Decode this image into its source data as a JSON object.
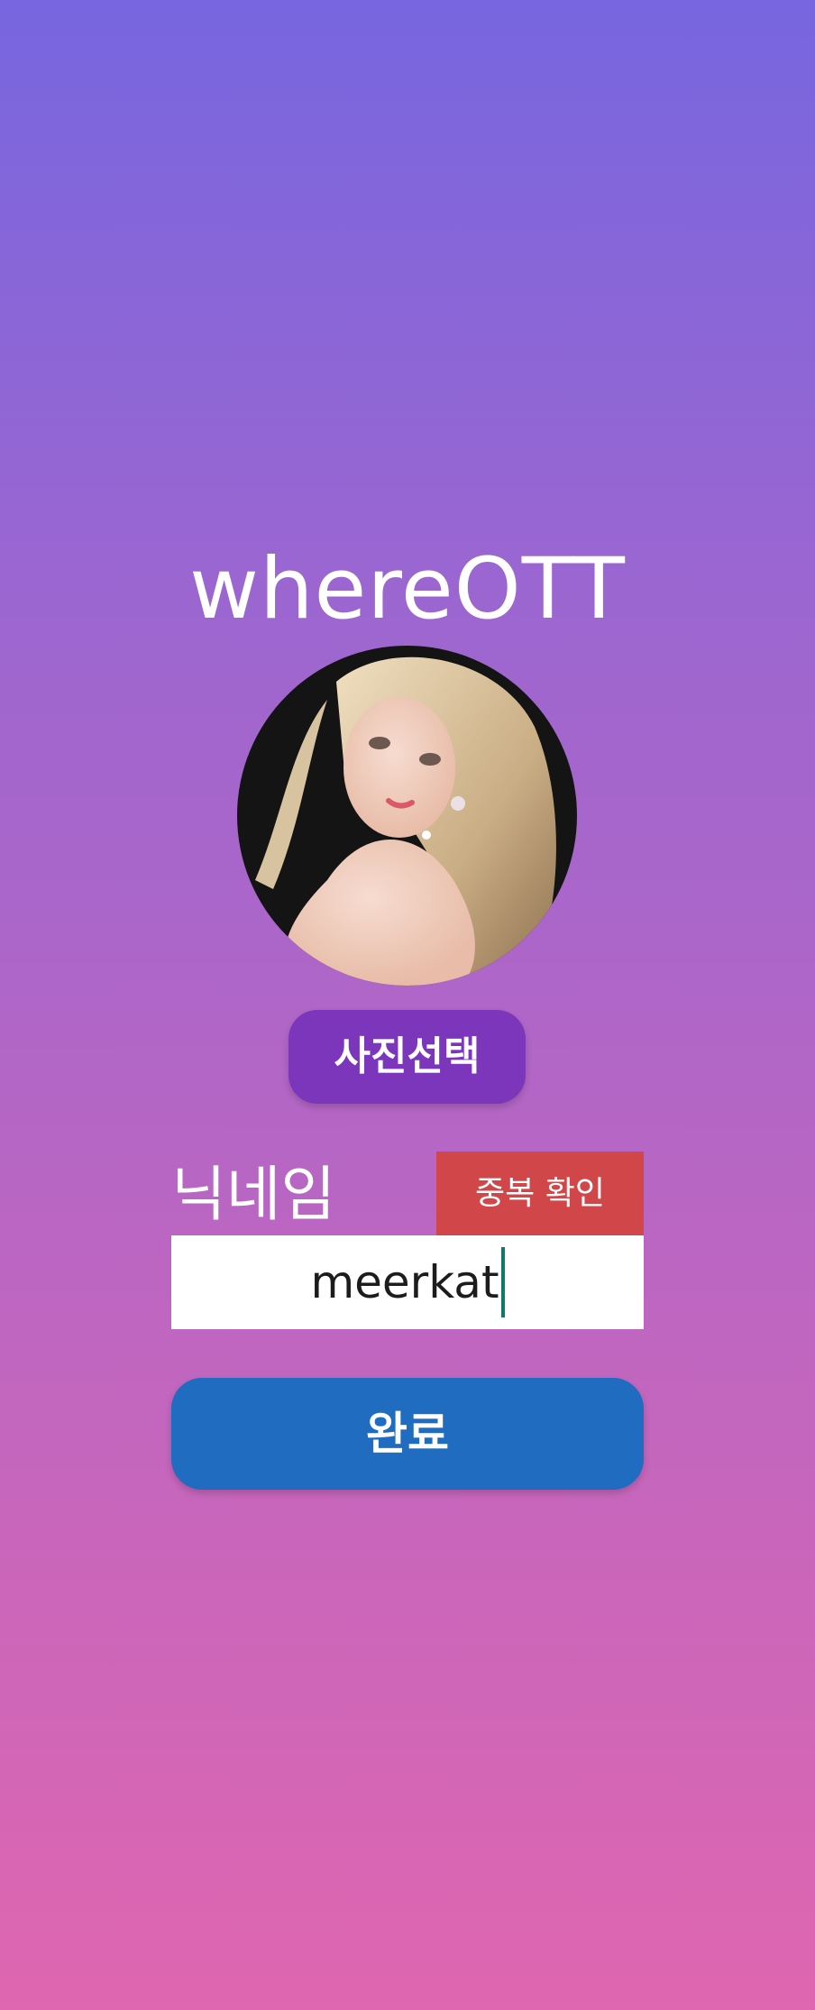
{
  "app": {
    "title": "whereOTT"
  },
  "profile": {
    "avatar_alt": "profile photo"
  },
  "buttons": {
    "select_photo": "사진선택",
    "duplicate_check": "중복 확인",
    "complete": "완료"
  },
  "nickname": {
    "label": "닉네임",
    "value": "meerkat"
  },
  "colors": {
    "gradient_top": "#7766df",
    "gradient_bottom": "#df66b0",
    "select_photo_bg": "#7b36bc",
    "duplicate_bg": "#d14649",
    "complete_bg": "#1f6cc0",
    "caret": "#0f7a6a"
  }
}
